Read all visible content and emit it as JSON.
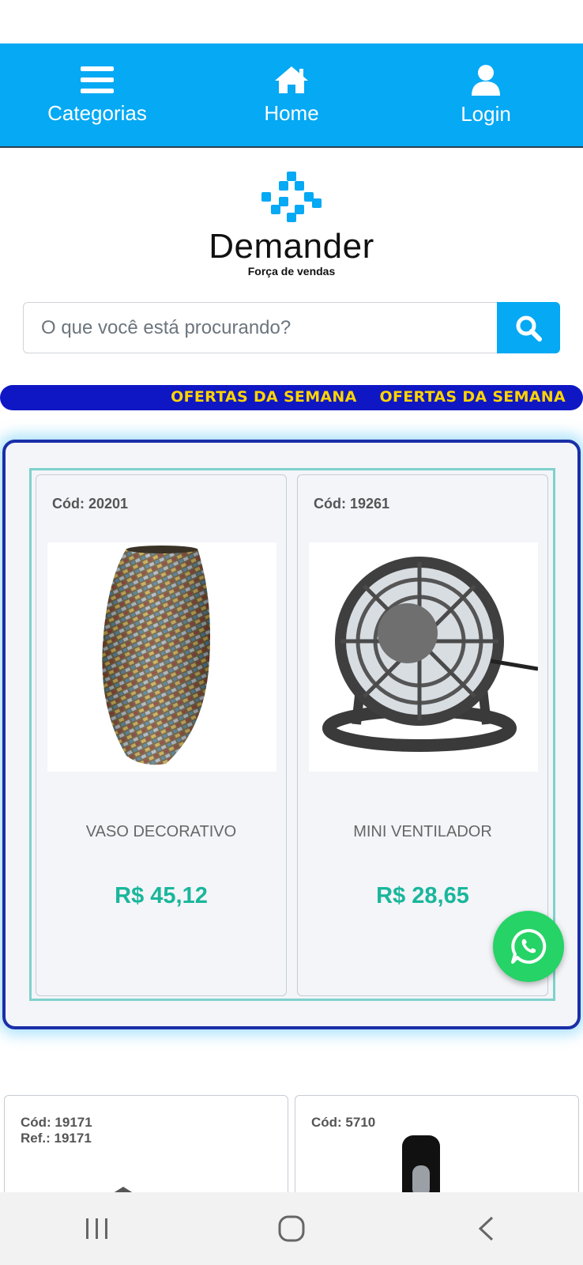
{
  "nav": {
    "items": [
      {
        "label": "Categorias",
        "icon": "menu-icon"
      },
      {
        "label": "Home",
        "icon": "home-icon"
      },
      {
        "label": "Login",
        "icon": "user-icon"
      }
    ]
  },
  "logo": {
    "name": "Demander",
    "tagline": "Força de vendas"
  },
  "search": {
    "placeholder": "O que você está procurando?",
    "value": ""
  },
  "ticker": {
    "items": [
      "OFERTAS DA SEMANA",
      "OFERTAS DA SEMANA"
    ]
  },
  "offers": {
    "products": [
      {
        "code": "Cód: 20201",
        "name": "VASO DECORATIVO",
        "price": "R$ 45,12",
        "image": "decorative-vase"
      },
      {
        "code": "Cód: 19261",
        "name": "MINI VENTILADOR",
        "price": "R$ 28,65",
        "image": "mini-fan"
      }
    ]
  },
  "more_products": [
    {
      "code": "Cód: 19171",
      "ref": "Ref.: 19171"
    },
    {
      "code": "Cód: 5710",
      "ref": ""
    }
  ],
  "colors": {
    "primary": "#05a9f4",
    "ticker_bg": "#0f17c4",
    "ticker_text": "#ffd400",
    "price": "#1ab69b",
    "offers_border": "#1a2fa8",
    "whatsapp": "#25d366"
  }
}
